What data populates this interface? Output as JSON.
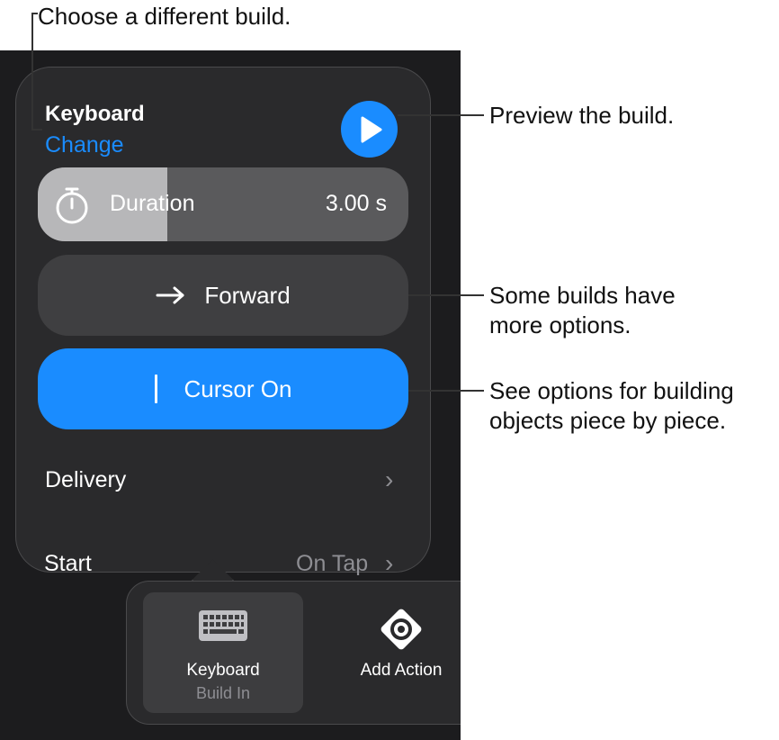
{
  "callouts": {
    "change_build": "Choose a different build.",
    "preview": "Preview the build.",
    "options_line1": "Some builds have",
    "options_line2": "more options.",
    "pieces_line1": "See options for building",
    "pieces_line2": "objects piece by piece."
  },
  "popover": {
    "build_name": "Keyboard",
    "change_label": "Change",
    "duration": {
      "label": "Duration",
      "value": "3.00 s",
      "fill_fraction": 0.35
    },
    "direction_button": {
      "label": "Forward",
      "icon": "arrow-right-icon"
    },
    "cursor_button": {
      "label": "Cursor On",
      "icon": "cursor-bar-icon"
    },
    "delivery": {
      "label": "Delivery"
    },
    "start": {
      "label": "Start",
      "value": "On Tap"
    }
  },
  "toolbar": {
    "items": [
      {
        "title": "Keyboard",
        "subtitle": "Build In",
        "icon": "keyboard-icon",
        "selected": true
      },
      {
        "title": "Add Action",
        "icon": "add-action-icon",
        "selected": false
      }
    ]
  },
  "colors": {
    "accent": "#1a8cff",
    "panel": "#2a2a2c",
    "background": "#1c1c1e"
  }
}
